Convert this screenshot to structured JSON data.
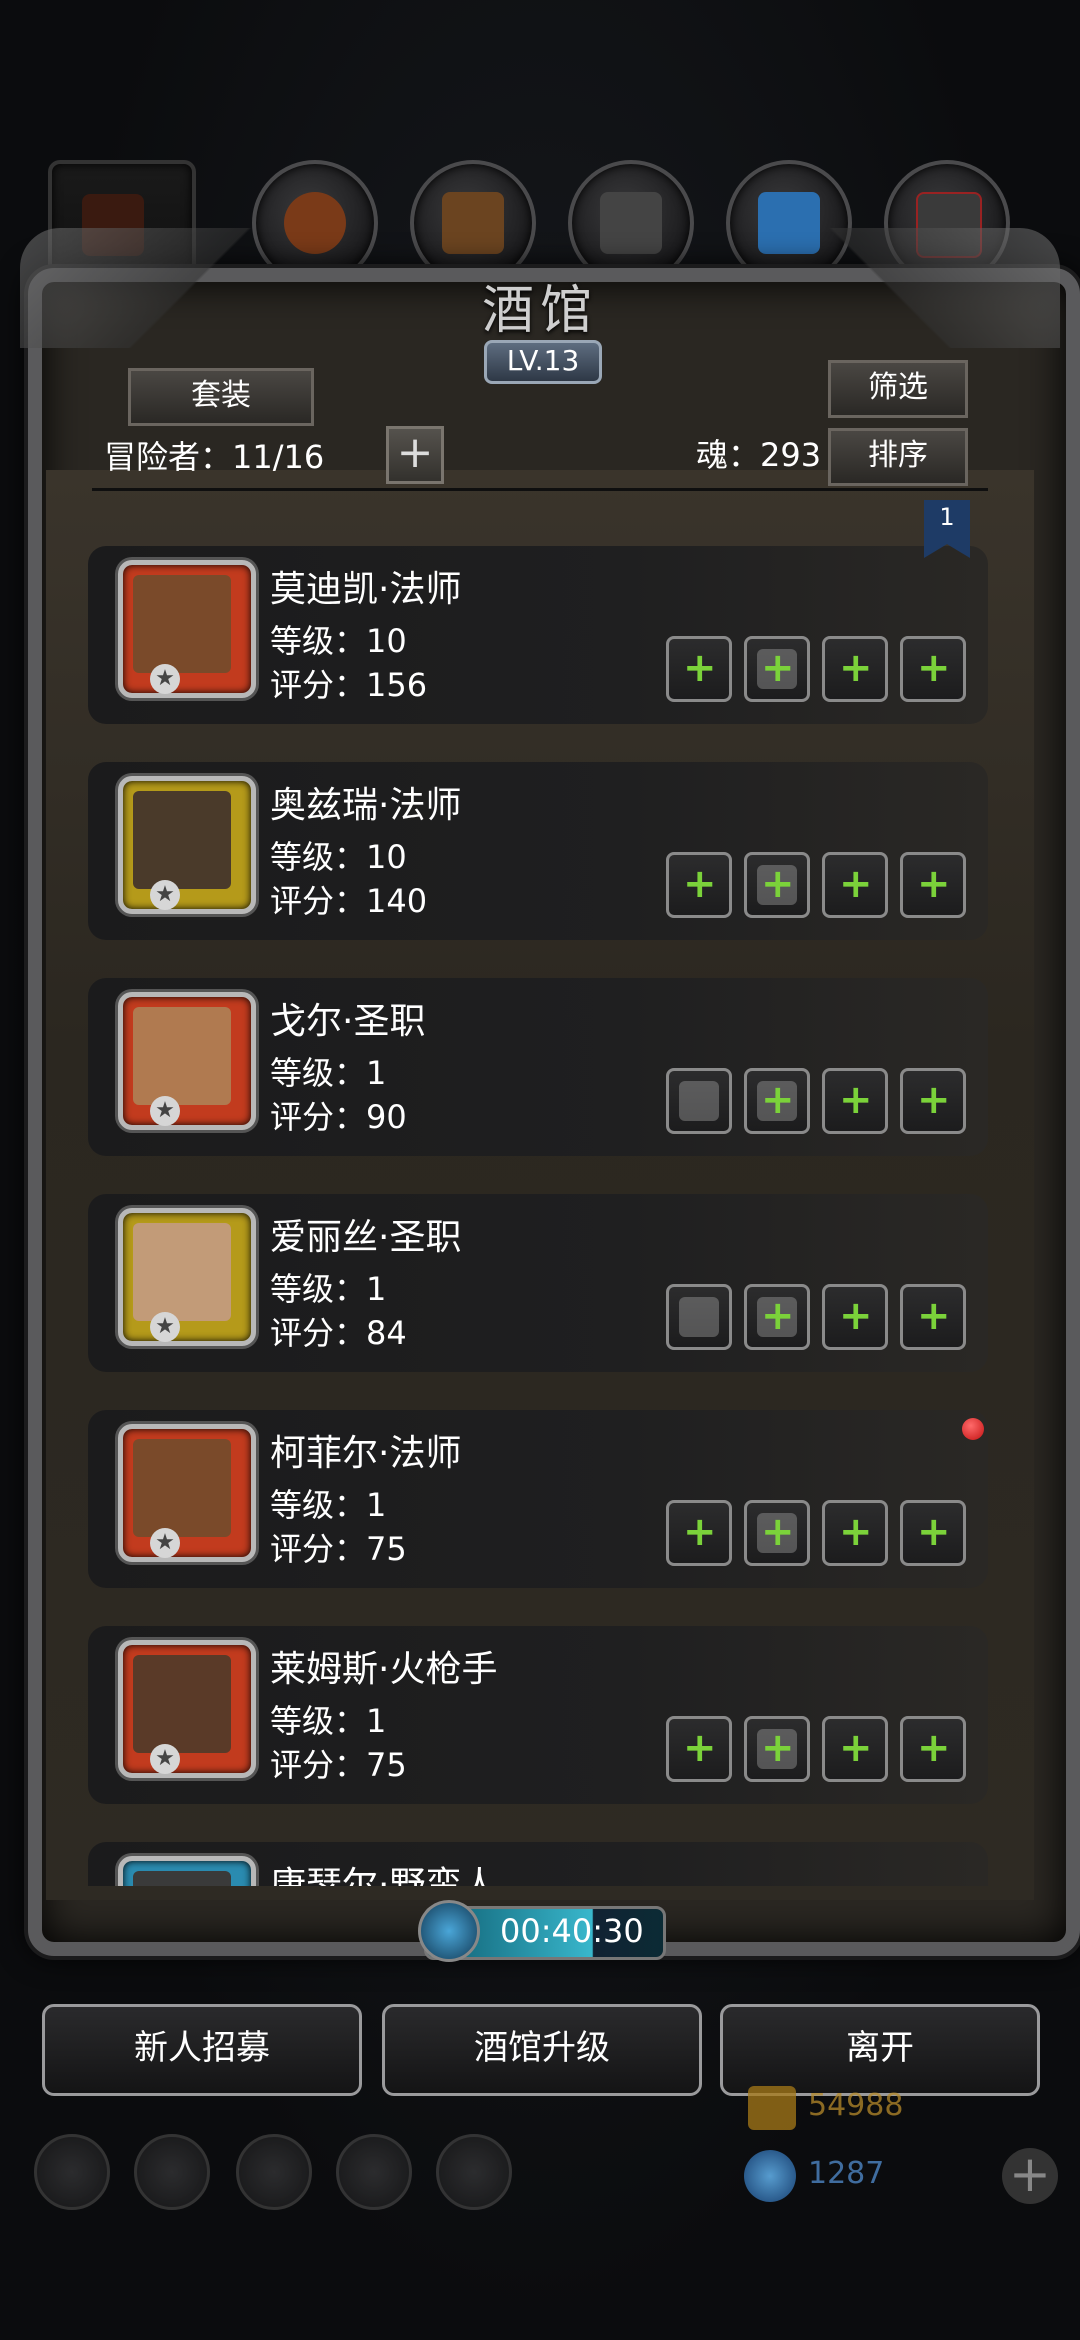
{
  "header": {
    "title": "酒馆",
    "level": "LV.13",
    "suit_label": "套装",
    "filter_label": "筛选",
    "sort_label": "排序",
    "adventurers_label": "冒险者：11/16",
    "soul_label": "魂：293",
    "page_marker": "1"
  },
  "heroes": [
    {
      "name": "莫迪凯·法师",
      "level": "等级：10",
      "score": "评分：156",
      "frame_color": "#c23b1e",
      "face_color": "#7a4a2a"
    },
    {
      "name": "奥兹瑞·法师",
      "level": "等级：10",
      "score": "评分：140",
      "frame_color": "#b59a1a",
      "face_color": "#4a3a2a"
    },
    {
      "name": "戈尔·圣职",
      "level": "等级：1",
      "score": "评分：90",
      "frame_color": "#c23b1e",
      "face_color": "#b07a50"
    },
    {
      "name": "爱丽丝·圣职",
      "level": "等级：1",
      "score": "评分：84",
      "frame_color": "#b59a1a",
      "face_color": "#c29b78"
    },
    {
      "name": "柯菲尔·法师",
      "level": "等级：1",
      "score": "评分：75",
      "frame_color": "#c23b1e",
      "face_color": "#7a4a2a"
    },
    {
      "name": "莱姆斯·火枪手",
      "level": "等级：1",
      "score": "评分：75",
      "frame_color": "#c23b1e",
      "face_color": "#5a3a28"
    },
    {
      "name": "康瑟尔·野蛮人",
      "level": "",
      "score": "",
      "frame_color": "#2a8bb0",
      "face_color": "#3a3a3a"
    }
  ],
  "timer": "00:40:30",
  "actions": {
    "recruit": "新人招募",
    "upgrade": "酒馆升级",
    "leave": "离开"
  },
  "currency": {
    "gold": "54988",
    "gems": "1287"
  },
  "colors": {
    "green_plus": "#7bd23a",
    "timer_fill": "#39b7cc"
  }
}
